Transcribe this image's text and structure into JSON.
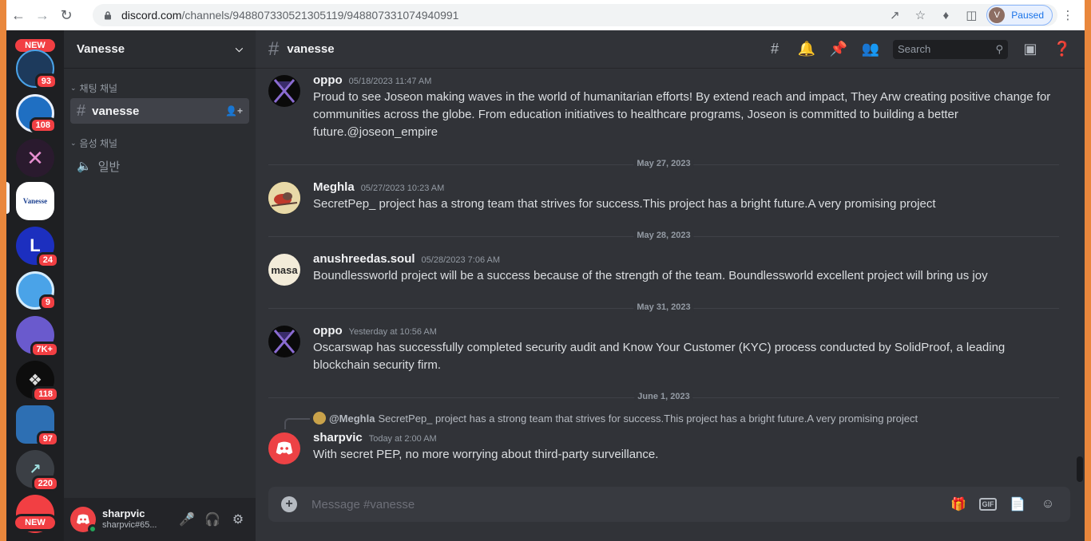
{
  "browser": {
    "url_host": "discord.com",
    "url_path": "/channels/948807330521305119/948807331074940991",
    "profile_initial": "V",
    "profile_status": "Paused"
  },
  "guilds": [
    {
      "badge": "93",
      "color": "#1d3a5c"
    },
    {
      "badge": "108",
      "color": "#1f6fc2"
    },
    {
      "badge": "",
      "color": "#2a1a2e"
    },
    {
      "label": "Vanesse",
      "badge": "",
      "color": "#ffffff"
    },
    {
      "badge": "24",
      "color": "#1c2fbf"
    },
    {
      "badge": "9",
      "color": "#4aa3e8"
    },
    {
      "badge": "7K+",
      "color": "#6a5acd"
    },
    {
      "badge": "118",
      "color": "#0d0d0d"
    },
    {
      "badge": "97",
      "color": "#2d6fb3"
    },
    {
      "badge": "220",
      "color": "#3b3f45"
    }
  ],
  "new_label": "NEW",
  "server": {
    "name": "Vanesse",
    "text_category": "채팅 채널",
    "text_channel": "vanesse",
    "voice_category": "음성 채널",
    "voice_channel": "일반"
  },
  "user": {
    "name": "sharpvic",
    "tag": "sharpvic#65..."
  },
  "channel": {
    "title": "vanesse",
    "search_placeholder": "Search"
  },
  "messages": [
    {
      "author": "oppo",
      "time": "05/18/2023 11:47 AM",
      "text": "Proud to see Joseon making waves in the world of humanitarian efforts! By extend reach and impact, They Arw creating positive change for communities across the globe. From education initiatives to healthcare programs, Joseon is committed to building a better future.@joseon_empire"
    },
    {
      "author": "Meghla",
      "time": "05/27/2023 10:23 AM",
      "text": "SecretPep_ project has a strong team that strives for success.This project has a bright future.A very promising project"
    },
    {
      "author": "anushreedas.soul",
      "time": "05/28/2023 7:06 AM",
      "text": "Boundlessworld project will be a success because of the strength of the team. Boundlessworld  excellent project will bring us joy",
      "avatar_text": "masa"
    },
    {
      "author": "oppo",
      "time": "Yesterday at 10:56 AM",
      "text": "Oscarswap has successfully completed  security audit and Know Your Customer (KYC) process conducted by SolidProof, a leading blockchain security firm."
    },
    {
      "author": "sharpvic",
      "time": "Today at 2:00 AM",
      "text": "With secret PEP, no more worrying about third-party surveillance."
    }
  ],
  "dividers": [
    "May 27, 2023",
    "May 28, 2023",
    "May 31, 2023",
    "June 1, 2023"
  ],
  "reply": {
    "author": "@Meghla",
    "text": "SecretPep_ project has a strong team that strives for success.This project has a bright future.A very promising project"
  },
  "composer": {
    "placeholder": "Message #vanesse",
    "gif_label": "GIF"
  }
}
